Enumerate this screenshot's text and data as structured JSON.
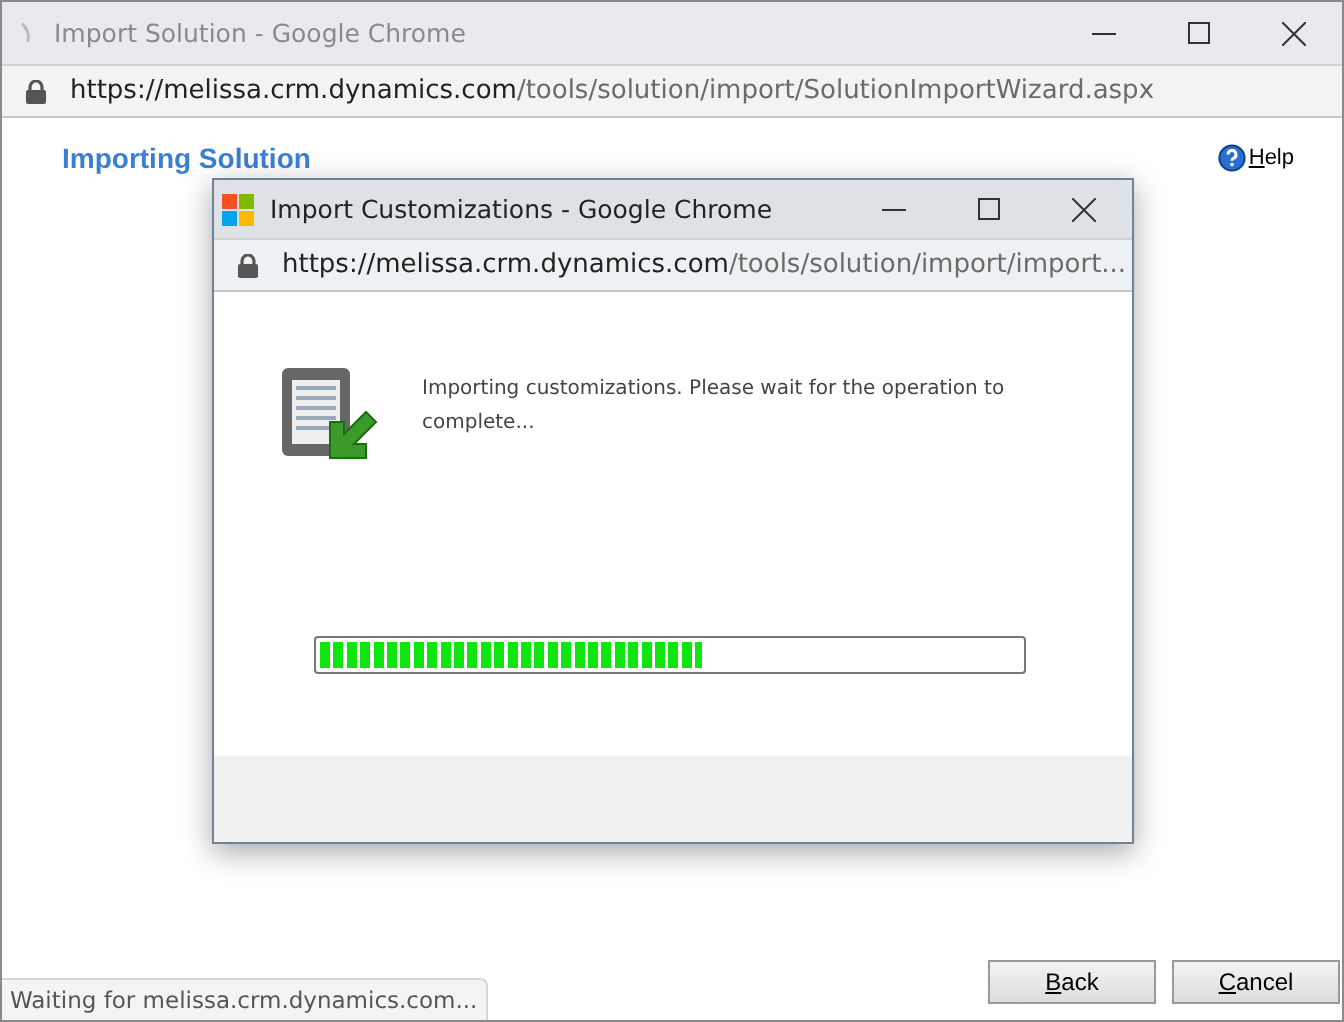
{
  "window": {
    "title": "Import Solution - Google Chrome",
    "url_host": "https://melissa.crm.dynamics.com",
    "url_path": "/tools/solution/import/SolutionImportWizard.aspx"
  },
  "page": {
    "heading": "Importing Solution",
    "help": "Help"
  },
  "dialog": {
    "title": "Import Customizations - Google Chrome",
    "url_host": "https://melissa.crm.dynamics.com",
    "url_path": "/tools/solution/import/import...",
    "message": "Importing customizations. Please wait for the operation to complete...",
    "progress": {
      "level": 0.545
    }
  },
  "buttons": [
    {
      "label": "Back"
    },
    {
      "label": "Cancel"
    }
  ],
  "status_bar": "Waiting for melissa.crm.dynamics.com..."
}
